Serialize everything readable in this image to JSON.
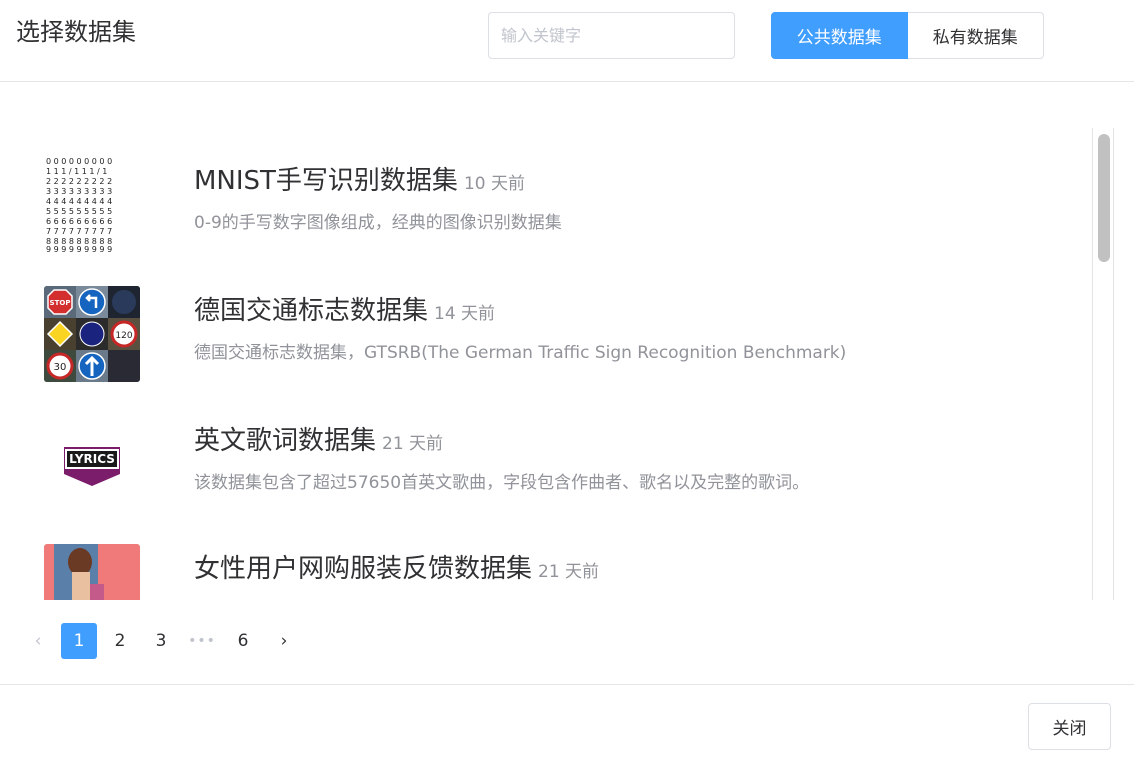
{
  "header": {
    "title": "选择数据集",
    "search_placeholder": "输入关键字",
    "tabs": [
      {
        "label": "公共数据集",
        "active": true
      },
      {
        "label": "私有数据集",
        "active": false
      }
    ]
  },
  "datasets": [
    {
      "title": "MNIST手写识别数据集",
      "time": "10 天前",
      "desc": "0-9的手写数字图像组成，经典的图像识别数据集",
      "icon": "mnist-digits"
    },
    {
      "title": "德国交通标志数据集",
      "time": "14 天前",
      "desc": "德国交通标志数据集，GTSRB(The German Traffic Sign Recognition Benchmark)",
      "icon": "traffic-signs"
    },
    {
      "title": "英文歌词数据集",
      "time": "21 天前",
      "desc": "该数据集包含了超过57650首英文歌曲，字段包含作曲者、歌名以及完整的歌词。",
      "icon": "lyrics-logo",
      "logo_text": "LYRICS"
    },
    {
      "title": "女性用户网购服装反馈数据集",
      "time": "21 天前",
      "desc": "",
      "icon": "fashion-photo"
    }
  ],
  "pagination": {
    "prev": "‹",
    "pages": [
      "1",
      "2",
      "3"
    ],
    "ellipsis": "•••",
    "last": "6",
    "next": "›",
    "current": "1"
  },
  "footer": {
    "close_label": "关闭"
  },
  "colors": {
    "accent": "#409eff",
    "border": "#dcdfe6",
    "muted_text": "#909399"
  }
}
